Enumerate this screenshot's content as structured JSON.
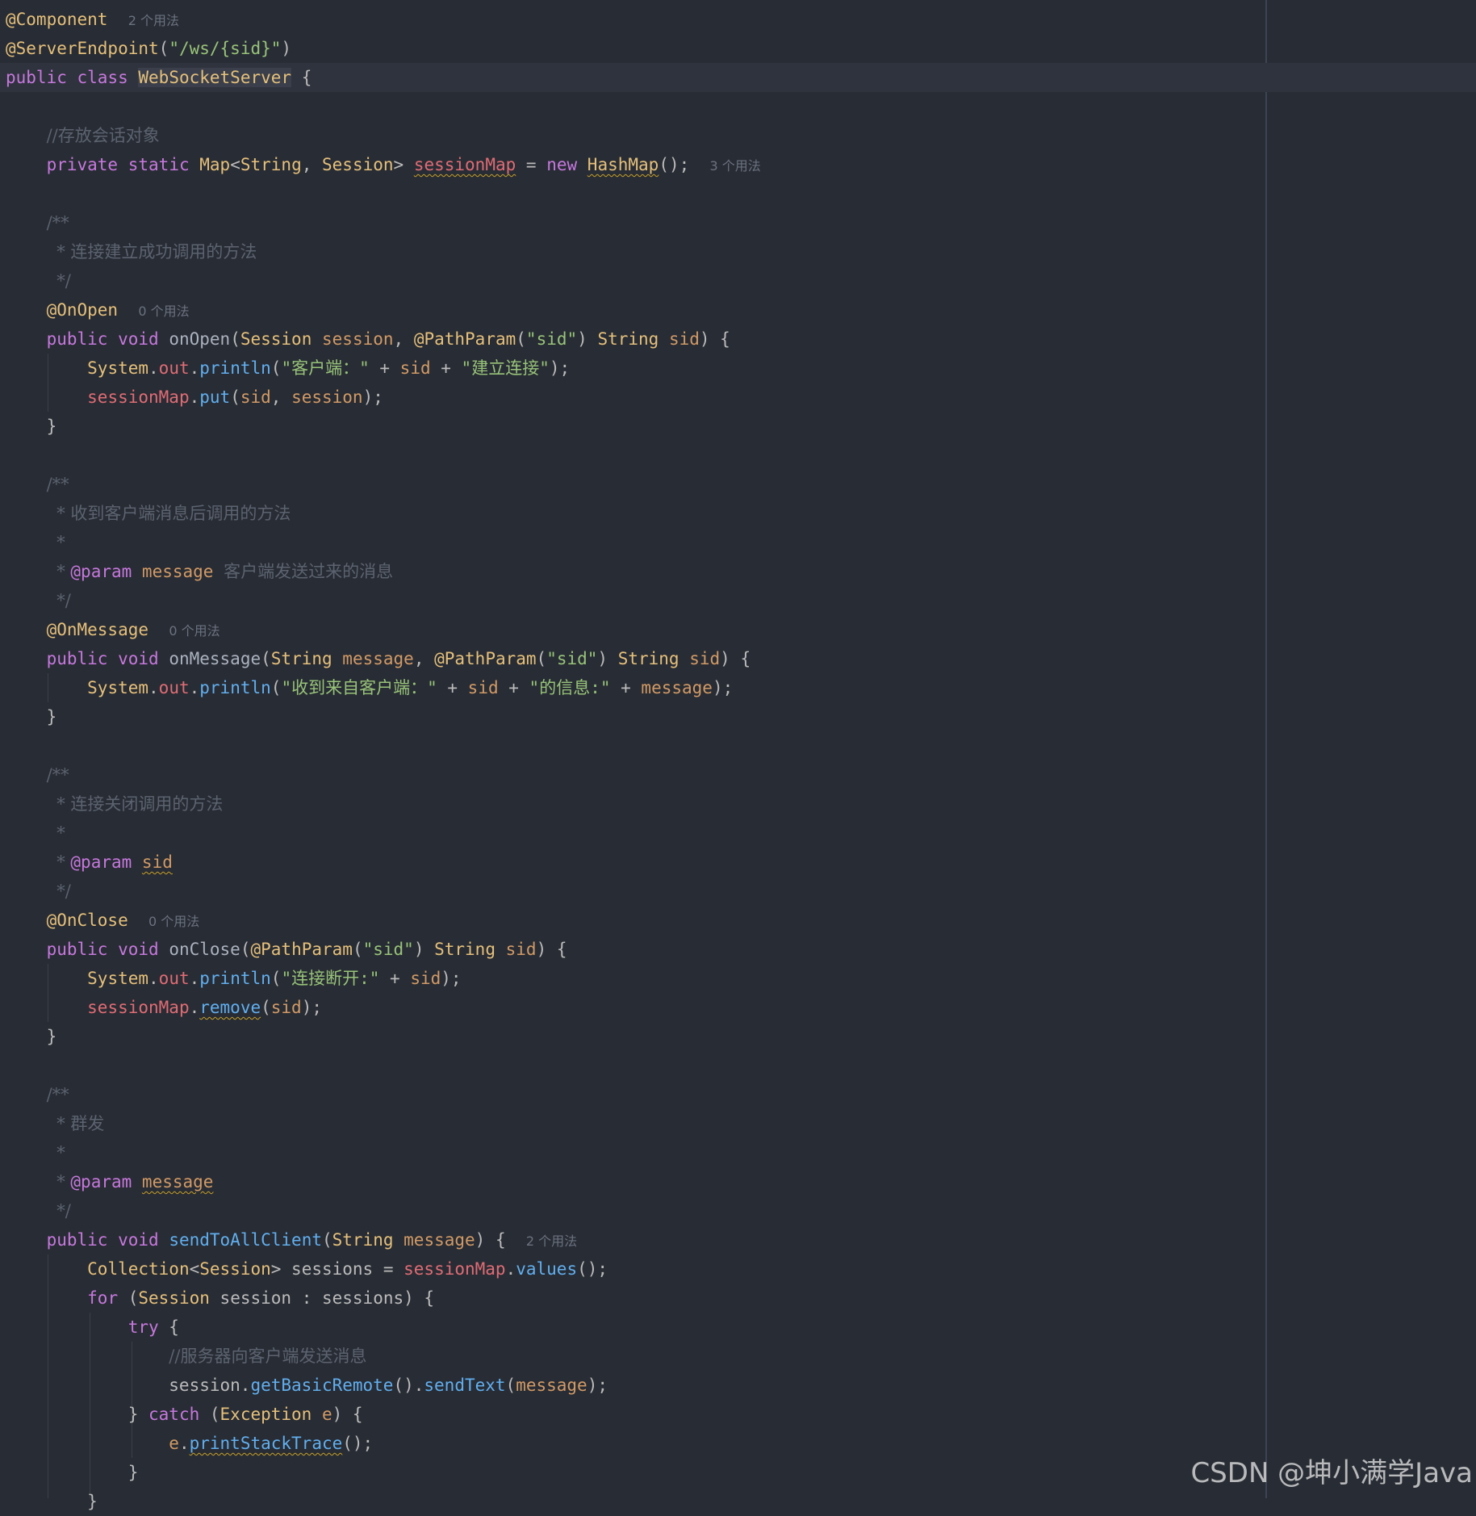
{
  "lines": [
    [
      [
        "ann",
        "@Component"
      ],
      [
        "dflt",
        "  "
      ],
      [
        "hint",
        "2 个用法"
      ]
    ],
    [
      [
        "ann",
        "@ServerEndpoint"
      ],
      [
        "dflt",
        "("
      ],
      [
        "str",
        "\"/ws/{sid}\""
      ],
      [
        "dflt",
        ")"
      ]
    ],
    [
      [
        "kw",
        "public"
      ],
      [
        "dflt",
        " "
      ],
      [
        "kw",
        "class"
      ],
      [
        "dflt",
        " "
      ],
      [
        "cls hl",
        "WebSocketServer"
      ],
      [
        "dflt",
        " {"
      ]
    ],
    [],
    [
      [
        "dflt",
        "    "
      ],
      [
        "cmt",
        "//存放会话对象"
      ]
    ],
    [
      [
        "dflt",
        "    "
      ],
      [
        "kw",
        "private"
      ],
      [
        "dflt",
        " "
      ],
      [
        "kw",
        "static"
      ],
      [
        "dflt",
        " "
      ],
      [
        "cls",
        "Map"
      ],
      [
        "dflt",
        "<"
      ],
      [
        "cls",
        "String"
      ],
      [
        "dflt",
        ", "
      ],
      [
        "cls",
        "Session"
      ],
      [
        "dflt",
        "> "
      ],
      [
        "fld squig",
        "sessionMap"
      ],
      [
        "dflt",
        " = "
      ],
      [
        "kw",
        "new"
      ],
      [
        "dflt",
        " "
      ],
      [
        "cls squig",
        "HashMap"
      ],
      [
        "dflt",
        "();  "
      ],
      [
        "hint",
        "3 个用法"
      ]
    ],
    [],
    [
      [
        "dflt",
        "    "
      ],
      [
        "cmt",
        "/**"
      ]
    ],
    [
      [
        "dflt",
        "     "
      ],
      [
        "cmt",
        "* 连接建立成功调用的方法"
      ]
    ],
    [
      [
        "dflt",
        "     "
      ],
      [
        "cmt",
        "*/"
      ]
    ],
    [
      [
        "dflt",
        "    "
      ],
      [
        "ann",
        "@OnOpen"
      ],
      [
        "dflt",
        "  "
      ],
      [
        "hint",
        "0 个用法"
      ]
    ],
    [
      [
        "dflt",
        "    "
      ],
      [
        "kw",
        "public"
      ],
      [
        "dflt",
        " "
      ],
      [
        "kw",
        "void"
      ],
      [
        "dflt",
        " "
      ],
      [
        "decl",
        "onOpen"
      ],
      [
        "dflt",
        "("
      ],
      [
        "cls",
        "Session"
      ],
      [
        "dflt",
        " "
      ],
      [
        "prm",
        "session"
      ],
      [
        "dflt",
        ", "
      ],
      [
        "ann",
        "@PathParam"
      ],
      [
        "dflt",
        "("
      ],
      [
        "str",
        "\"sid\""
      ],
      [
        "dflt",
        ") "
      ],
      [
        "cls",
        "String"
      ],
      [
        "dflt",
        " "
      ],
      [
        "prm",
        "sid"
      ],
      [
        "dflt",
        ") {"
      ]
    ],
    [
      [
        "dflt",
        "        "
      ],
      [
        "cls",
        "System"
      ],
      [
        "dflt",
        "."
      ],
      [
        "fld",
        "out"
      ],
      [
        "dflt",
        "."
      ],
      [
        "mth",
        "println"
      ],
      [
        "dflt",
        "("
      ],
      [
        "str",
        "\"客户端：\""
      ],
      [
        "dflt",
        " + "
      ],
      [
        "prm",
        "sid"
      ],
      [
        "dflt",
        " + "
      ],
      [
        "str",
        "\"建立连接\""
      ],
      [
        "dflt",
        ");"
      ]
    ],
    [
      [
        "dflt",
        "        "
      ],
      [
        "fld",
        "sessionMap"
      ],
      [
        "dflt",
        "."
      ],
      [
        "mth",
        "put"
      ],
      [
        "dflt",
        "("
      ],
      [
        "prm",
        "sid"
      ],
      [
        "dflt",
        ", "
      ],
      [
        "prm",
        "session"
      ],
      [
        "dflt",
        ");"
      ]
    ],
    [
      [
        "dflt",
        "    }"
      ]
    ],
    [],
    [
      [
        "dflt",
        "    "
      ],
      [
        "cmt",
        "/**"
      ]
    ],
    [
      [
        "dflt",
        "     "
      ],
      [
        "cmt",
        "* 收到客户端消息后调用的方法"
      ]
    ],
    [
      [
        "dflt",
        "     "
      ],
      [
        "cmt",
        "*"
      ]
    ],
    [
      [
        "dflt",
        "     "
      ],
      [
        "cmt",
        "* "
      ],
      [
        "tag",
        "@param"
      ],
      [
        "dflt",
        " "
      ],
      [
        "prm",
        "message"
      ],
      [
        "dflt",
        " "
      ],
      [
        "cmt",
        "客户端发送过来的消息"
      ]
    ],
    [
      [
        "dflt",
        "     "
      ],
      [
        "cmt",
        "*/"
      ]
    ],
    [
      [
        "dflt",
        "    "
      ],
      [
        "ann",
        "@OnMessage"
      ],
      [
        "dflt",
        "  "
      ],
      [
        "hint",
        "0 个用法"
      ]
    ],
    [
      [
        "dflt",
        "    "
      ],
      [
        "kw",
        "public"
      ],
      [
        "dflt",
        " "
      ],
      [
        "kw",
        "void"
      ],
      [
        "dflt",
        " "
      ],
      [
        "decl",
        "onMessage"
      ],
      [
        "dflt",
        "("
      ],
      [
        "cls",
        "String"
      ],
      [
        "dflt",
        " "
      ],
      [
        "prm",
        "message"
      ],
      [
        "dflt",
        ", "
      ],
      [
        "ann",
        "@PathParam"
      ],
      [
        "dflt",
        "("
      ],
      [
        "str",
        "\"sid\""
      ],
      [
        "dflt",
        ") "
      ],
      [
        "cls",
        "String"
      ],
      [
        "dflt",
        " "
      ],
      [
        "prm",
        "sid"
      ],
      [
        "dflt",
        ") {"
      ]
    ],
    [
      [
        "dflt",
        "        "
      ],
      [
        "cls",
        "System"
      ],
      [
        "dflt",
        "."
      ],
      [
        "fld",
        "out"
      ],
      [
        "dflt",
        "."
      ],
      [
        "mth",
        "println"
      ],
      [
        "dflt",
        "("
      ],
      [
        "str",
        "\"收到来自客户端：\""
      ],
      [
        "dflt",
        " + "
      ],
      [
        "prm",
        "sid"
      ],
      [
        "dflt",
        " + "
      ],
      [
        "str",
        "\"的信息:\""
      ],
      [
        "dflt",
        " + "
      ],
      [
        "prm",
        "message"
      ],
      [
        "dflt",
        ");"
      ]
    ],
    [
      [
        "dflt",
        "    }"
      ]
    ],
    [],
    [
      [
        "dflt",
        "    "
      ],
      [
        "cmt",
        "/**"
      ]
    ],
    [
      [
        "dflt",
        "     "
      ],
      [
        "cmt",
        "* 连接关闭调用的方法"
      ]
    ],
    [
      [
        "dflt",
        "     "
      ],
      [
        "cmt",
        "*"
      ]
    ],
    [
      [
        "dflt",
        "     "
      ],
      [
        "cmt",
        "* "
      ],
      [
        "tag",
        "@param"
      ],
      [
        "dflt",
        " "
      ],
      [
        "prm squig",
        "sid"
      ]
    ],
    [
      [
        "dflt",
        "     "
      ],
      [
        "cmt",
        "*/"
      ]
    ],
    [
      [
        "dflt",
        "    "
      ],
      [
        "ann",
        "@OnClose"
      ],
      [
        "dflt",
        "  "
      ],
      [
        "hint",
        "0 个用法"
      ]
    ],
    [
      [
        "dflt",
        "    "
      ],
      [
        "kw",
        "public"
      ],
      [
        "dflt",
        " "
      ],
      [
        "kw",
        "void"
      ],
      [
        "dflt",
        " "
      ],
      [
        "decl",
        "onClose"
      ],
      [
        "dflt",
        "("
      ],
      [
        "ann",
        "@PathParam"
      ],
      [
        "dflt",
        "("
      ],
      [
        "str",
        "\"sid\""
      ],
      [
        "dflt",
        ") "
      ],
      [
        "cls",
        "String"
      ],
      [
        "dflt",
        " "
      ],
      [
        "prm",
        "sid"
      ],
      [
        "dflt",
        ") {"
      ]
    ],
    [
      [
        "dflt",
        "        "
      ],
      [
        "cls",
        "System"
      ],
      [
        "dflt",
        "."
      ],
      [
        "fld",
        "out"
      ],
      [
        "dflt",
        "."
      ],
      [
        "mth",
        "println"
      ],
      [
        "dflt",
        "("
      ],
      [
        "str",
        "\"连接断开:\""
      ],
      [
        "dflt",
        " + "
      ],
      [
        "prm",
        "sid"
      ],
      [
        "dflt",
        ");"
      ]
    ],
    [
      [
        "dflt",
        "        "
      ],
      [
        "fld",
        "sessionMap"
      ],
      [
        "dflt",
        "."
      ],
      [
        "mth squig",
        "remove"
      ],
      [
        "dflt",
        "("
      ],
      [
        "prm",
        "sid"
      ],
      [
        "dflt",
        ");"
      ]
    ],
    [
      [
        "dflt",
        "    }"
      ]
    ],
    [],
    [
      [
        "dflt",
        "    "
      ],
      [
        "cmt",
        "/**"
      ]
    ],
    [
      [
        "dflt",
        "     "
      ],
      [
        "cmt",
        "* 群发"
      ]
    ],
    [
      [
        "dflt",
        "     "
      ],
      [
        "cmt",
        "*"
      ]
    ],
    [
      [
        "dflt",
        "     "
      ],
      [
        "cmt",
        "* "
      ],
      [
        "tag",
        "@param"
      ],
      [
        "dflt",
        " "
      ],
      [
        "prm squig",
        "message"
      ]
    ],
    [
      [
        "dflt",
        "     "
      ],
      [
        "cmt",
        "*/"
      ]
    ],
    [
      [
        "dflt",
        "    "
      ],
      [
        "kw",
        "public"
      ],
      [
        "dflt",
        " "
      ],
      [
        "kw",
        "void"
      ],
      [
        "dflt",
        " "
      ],
      [
        "mth",
        "sendToAllClient"
      ],
      [
        "dflt",
        "("
      ],
      [
        "cls",
        "String"
      ],
      [
        "dflt",
        " "
      ],
      [
        "prm",
        "message"
      ],
      [
        "dflt",
        ") {  "
      ],
      [
        "hint",
        "2 个用法"
      ]
    ],
    [
      [
        "dflt",
        "        "
      ],
      [
        "cls",
        "Collection"
      ],
      [
        "dflt",
        "<"
      ],
      [
        "cls",
        "Session"
      ],
      [
        "dflt",
        "> sessions = "
      ],
      [
        "fld",
        "sessionMap"
      ],
      [
        "dflt",
        "."
      ],
      [
        "mth",
        "values"
      ],
      [
        "dflt",
        "();"
      ]
    ],
    [
      [
        "dflt",
        "        "
      ],
      [
        "kw",
        "for"
      ],
      [
        "dflt",
        " ("
      ],
      [
        "cls",
        "Session"
      ],
      [
        "dflt",
        " session : sessions) {"
      ]
    ],
    [
      [
        "dflt",
        "            "
      ],
      [
        "kw",
        "try"
      ],
      [
        "dflt",
        " {"
      ]
    ],
    [
      [
        "dflt",
        "                "
      ],
      [
        "cmt",
        "//服务器向客户端发送消息"
      ]
    ],
    [
      [
        "dflt",
        "                session."
      ],
      [
        "mth",
        "getBasicRemote"
      ],
      [
        "dflt",
        "()."
      ],
      [
        "mth",
        "sendText"
      ],
      [
        "dflt",
        "("
      ],
      [
        "prm",
        "message"
      ],
      [
        "dflt",
        ");"
      ]
    ],
    [
      [
        "dflt",
        "            } "
      ],
      [
        "kw",
        "catch"
      ],
      [
        "dflt",
        " ("
      ],
      [
        "cls",
        "Exception"
      ],
      [
        "dflt",
        " "
      ],
      [
        "prm",
        "e"
      ],
      [
        "dflt",
        ") {"
      ]
    ],
    [
      [
        "dflt",
        "                "
      ],
      [
        "prm",
        "e"
      ],
      [
        "dflt",
        "."
      ],
      [
        "mth squig",
        "printStackTrace"
      ],
      [
        "dflt",
        "();"
      ]
    ],
    [
      [
        "dflt",
        "            }"
      ]
    ],
    [
      [
        "dflt",
        "        }"
      ]
    ]
  ],
  "current_line": 2,
  "watermark": "CSDN @坤小满学Java"
}
